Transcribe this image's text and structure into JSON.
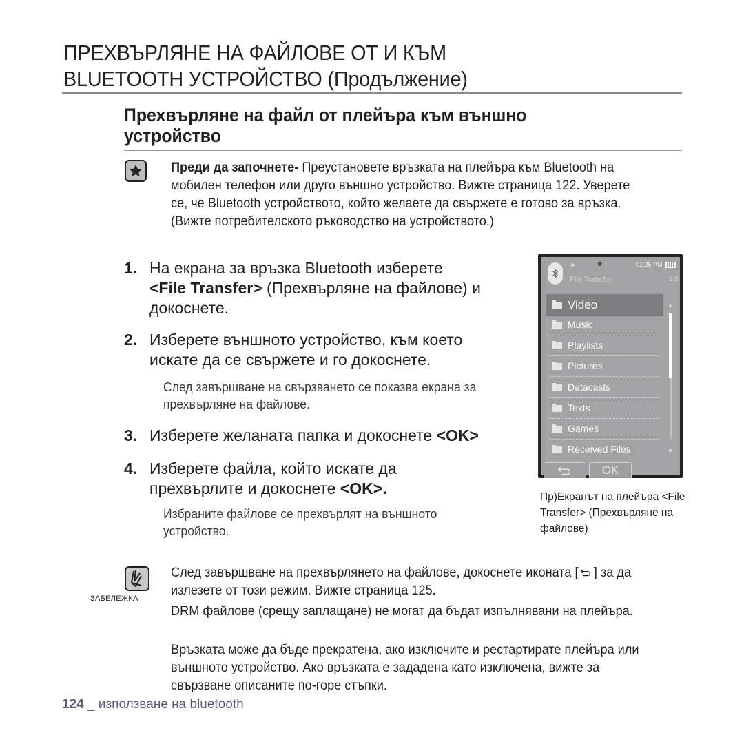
{
  "page": {
    "title_line1": "ПРЕХВЪРЛЯНЕ НА ФАЙЛОВЕ ОТ И КЪМ",
    "title_line2": "BLUETOOTH УСТРОЙСТВО (Продължение)",
    "section_title_line1": "Прехвърляне на файл от плейъра към външно",
    "section_title_line2": "устройство"
  },
  "before_start": {
    "icon": "star-icon",
    "label": "Преди да започнете-",
    "text": " Преустановете връзката на плейъра към Bluetooth на мобилен телефон или друго външно устройство. Вижте страница 122. Уверете се, че Bluetooth устройството, който желаете да свържете е готово за връзка.(Вижте потребителското ръководство на устройството.)"
  },
  "steps": [
    {
      "num": "1.",
      "text_a": "На екрана за връзка Bluetooth изберете",
      "bold": "<File Transfer>",
      "text_b": " (Прехвърляне на файлове) и докоснете."
    },
    {
      "num": "2.",
      "text": "Изберете външното устройство, към което искате да се свържете и го докоснете.",
      "sub": "След завършване на свързването се показва екрана за прехвърляне на файлове."
    },
    {
      "num": "3.",
      "text": "Изберете желаната папка и докоснете ",
      "bold": "<OK>"
    },
    {
      "num": "4.",
      "text": "Изберете файла, който искате да прехвърлите и докоснете ",
      "bold": "<OK>.",
      "sub": "Избраните файлове се прехвърлят на външното устройство."
    }
  ],
  "device_screen": {
    "status_time": "01:25 PM",
    "title": "File Transfer",
    "page_indicator": "1/8",
    "items": [
      {
        "label": "Video",
        "selected": true
      },
      {
        "label": "Music",
        "selected": false
      },
      {
        "label": "Playlists",
        "selected": false
      },
      {
        "label": "Pictures",
        "selected": false
      },
      {
        "label": "Datacasts",
        "selected": false
      },
      {
        "label": "Texts",
        "selected": false
      },
      {
        "label": "Games",
        "selected": false
      },
      {
        "label": "Received Files",
        "selected": false
      }
    ],
    "back_button_icon": "back-arrow-icon",
    "ok_button": "OK"
  },
  "caption": "Пр)Екранът на плейъра <File Transfer> (Прехвърляне на файлове)",
  "note": {
    "label": "ЗАБЕЛЕЖКА",
    "item1_a": "След завършване на прехвърлянето на файлове, докоснете иконата [",
    "item1_b": "] за да излезете от този режим. Вижте страница 125.",
    "item2": "DRM файлове (срещу заплащане) не могат да бъдат изпълнявани на плейъра.",
    "item3": "Връзката може да бъде прекратена, ако изключите и рестартирате плейъра или външното устройство. Ако връзката е зададена като изключена, вижте за свързване описаните по-горе стъпки."
  },
  "footer": {
    "page_number": "124",
    "text": " _ използване на bluetooth"
  }
}
